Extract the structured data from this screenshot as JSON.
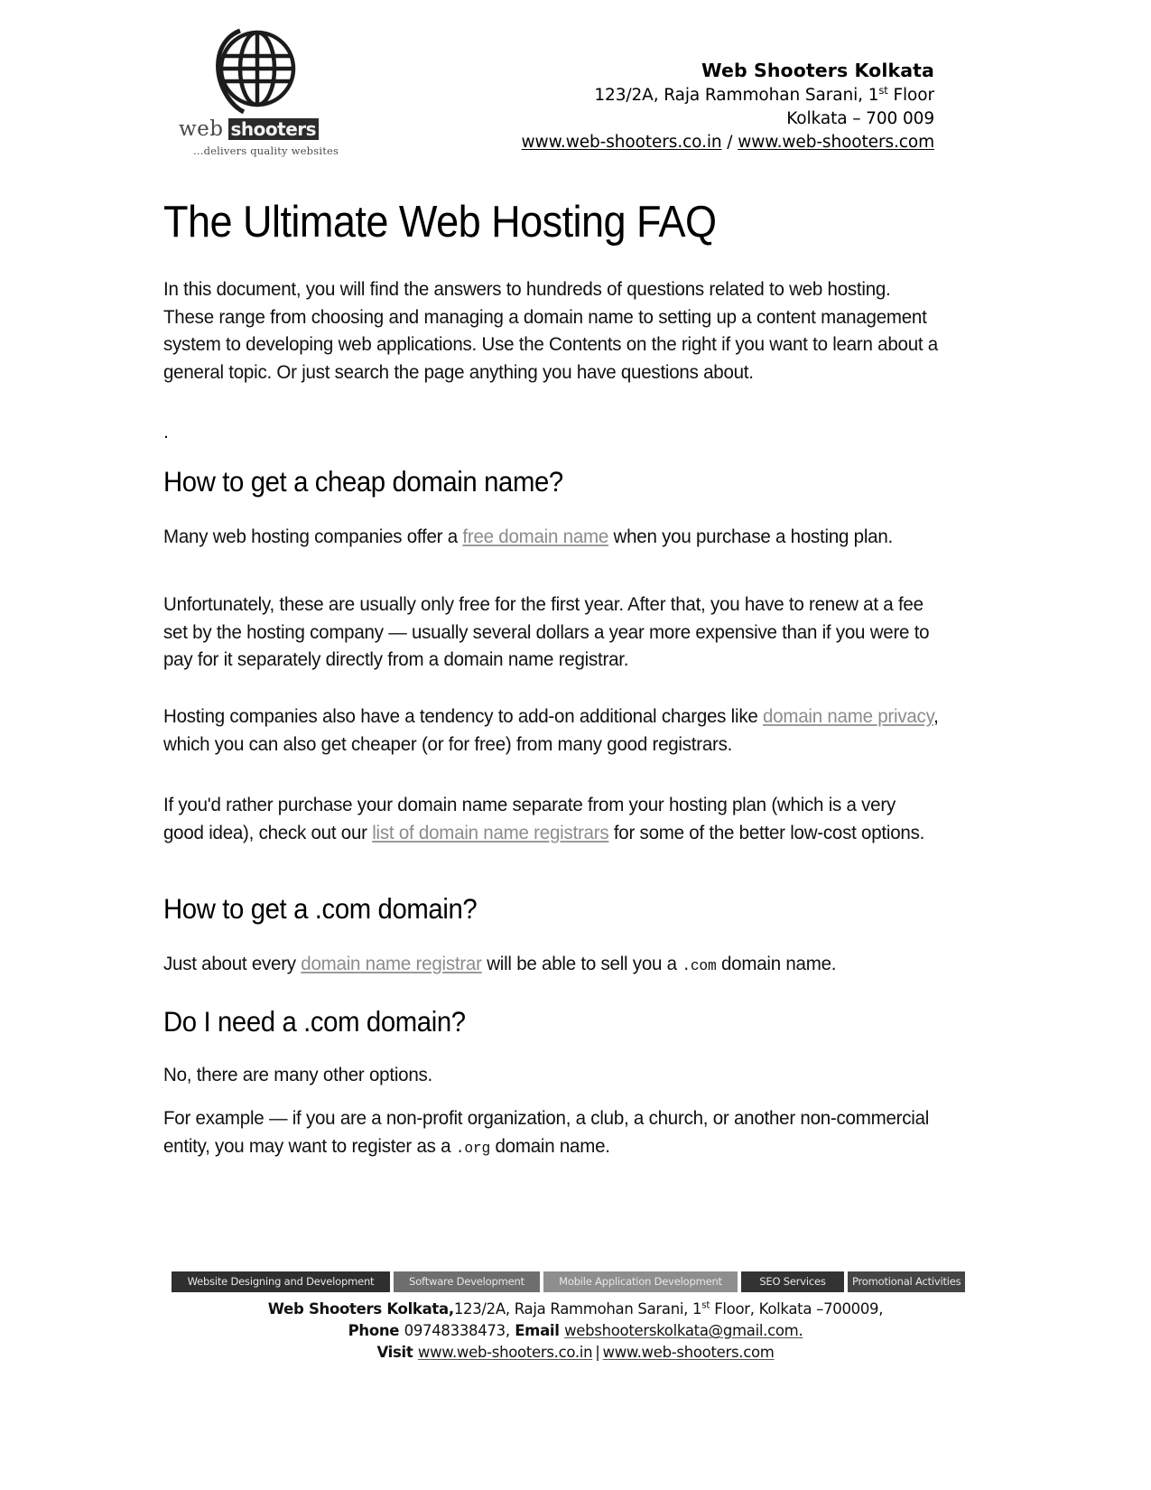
{
  "letterhead": {
    "logo": {
      "word_primary": "web",
      "word_secondary": "shooters",
      "tagline": "...delivers quality websites",
      "globe_icon": "globe-icon"
    },
    "company_name": "Web Shooters Kolkata",
    "address_line": "123/2A, Raja Rammohan Sarani, 1",
    "address_ordinal": "st",
    "address_suffix": " Floor",
    "city_line": "Kolkata – 700 009",
    "site_1": "www.web-shooters.co.in",
    "site_divider": " / ",
    "site_2": "www.web-shooters.com"
  },
  "document": {
    "title": "The Ultimate Web Hosting FAQ",
    "intro": "In this document, you will find the answers to hundreds of questions related to web hosting. These range from choosing and managing a domain name to setting up a content management system to developing web applications. Use the Contents on the right if you want to learn about a general topic. Or just search the page anything you have questions about.",
    "spacer_dot": ".",
    "sections": [
      {
        "heading": "How to get a cheap domain name?",
        "p1_a": "Many web hosting companies offer a ",
        "p1_link": "free domain name",
        "p1_b": " when you purchase a hosting plan.",
        "p2": "Unfortunately, these are usually only free for the first year. After that, you have to renew at a fee set by the hosting company — usually several dollars a year more expensive than if you were to pay for it separately directly from a domain name registrar.",
        "p3_a": "Hosting companies also have a tendency to add-on additional charges like ",
        "p3_link": "domain name privacy",
        "p3_b": ", which you can also get cheaper (or for free) from many good registrars.",
        "p4_a": "If you'd rather purchase your domain name separate from your hosting plan (which is a very good idea), check out our ",
        "p4_link": "list of domain name registrars",
        "p4_b": " for some of the better low-cost options."
      },
      {
        "heading": "How to get a .com domain?",
        "p1_a": "Just about every ",
        "p1_link": "domain name registrar",
        "p1_b": " will be able to sell you a ",
        "p1_code": ".com",
        "p1_c": " domain name."
      },
      {
        "heading": "Do I need a .com domain?",
        "p1": "No, there are many other options.",
        "p2_a": "For example — if you are a non-profit organization, a club, a church, or another non-commercial entity, you may want to register as a ",
        "p2_code": ".org",
        "p2_b": " domain name."
      }
    ]
  },
  "footer": {
    "services": [
      "Website Designing and Development",
      "Software Development",
      "Mobile Application Development",
      "SEO Services",
      "Promotional Activities"
    ],
    "line1_bold": "Web Shooters Kolkata,",
    "line1_rest_a": "123/2A, Raja Rammohan Sarani, 1",
    "line1_ordinal": "st",
    "line1_rest_b": " Floor, Kolkata –700009,",
    "phone_label": "Phone ",
    "phone_value": "09748338473,",
    "email_label": " Email ",
    "email_value": "webshooterskolkata@gmail.com.",
    "visit_label": "Visit ",
    "visit_site_1": "www.web-shooters.co.in",
    "visit_divider": "|",
    "visit_site_2": "www.web-shooters.com"
  },
  "colors": {
    "text": "#000000",
    "link": "#8c8c8c",
    "badge_dark": "#2f2f2f",
    "badge_mid": "#6e6e6e",
    "badge_light": "#8e8e8e"
  }
}
